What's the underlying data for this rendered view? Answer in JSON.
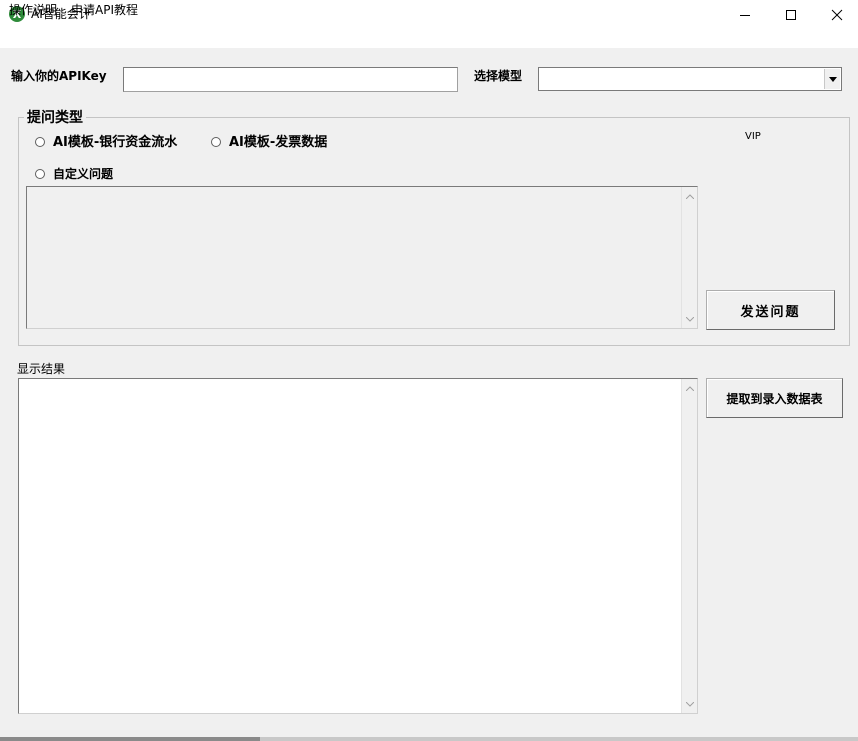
{
  "window": {
    "title": "AI智能会计",
    "icon": "excel-x-icon",
    "icon_glyph": "X",
    "controls": {
      "minimize": "—",
      "maximize": "☐",
      "close": "✕"
    }
  },
  "menu": {
    "items": [
      {
        "label": "操作说明"
      },
      {
        "label": "申请API教程"
      }
    ]
  },
  "apikey": {
    "label": "输入你的APIKey",
    "value": "",
    "placeholder": ""
  },
  "model": {
    "label": "选择模型",
    "selected": "",
    "arrow": "▾"
  },
  "question_type": {
    "title": "提问类型",
    "options": [
      {
        "label": "AI模板-银行资金流水",
        "selected": false
      },
      {
        "label": "AI模板-发票数据",
        "selected": false
      },
      {
        "label": "自定义问题",
        "selected": false
      }
    ],
    "vip_label": "VIP",
    "question_text": "",
    "send_button": "发送问题"
  },
  "result": {
    "label": "显示结果",
    "text": "",
    "extract_button": "提取到录入数据表"
  },
  "scroll": {
    "up": "▲",
    "down": "▼"
  }
}
